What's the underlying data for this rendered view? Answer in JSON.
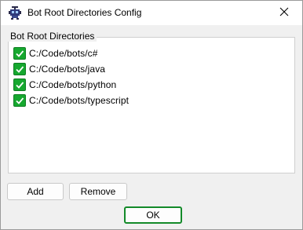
{
  "window": {
    "title": "Bot Root Directories Config"
  },
  "group": {
    "title": "Bot Root Directories",
    "items": [
      {
        "label": "C:/Code/bots/c#",
        "checked": true
      },
      {
        "label": "C:/Code/bots/java",
        "checked": true
      },
      {
        "label": "C:/Code/bots/python",
        "checked": true
      },
      {
        "label": "C:/Code/bots/typescript",
        "checked": true
      }
    ]
  },
  "buttons": {
    "add": "Add",
    "remove": "Remove",
    "ok": "OK"
  },
  "colors": {
    "checkbox": "#16a82f",
    "ok_border": "#138a29"
  },
  "icons": {
    "app": "robot-app-icon",
    "close": "close-icon",
    "check": "checkmark-icon"
  }
}
